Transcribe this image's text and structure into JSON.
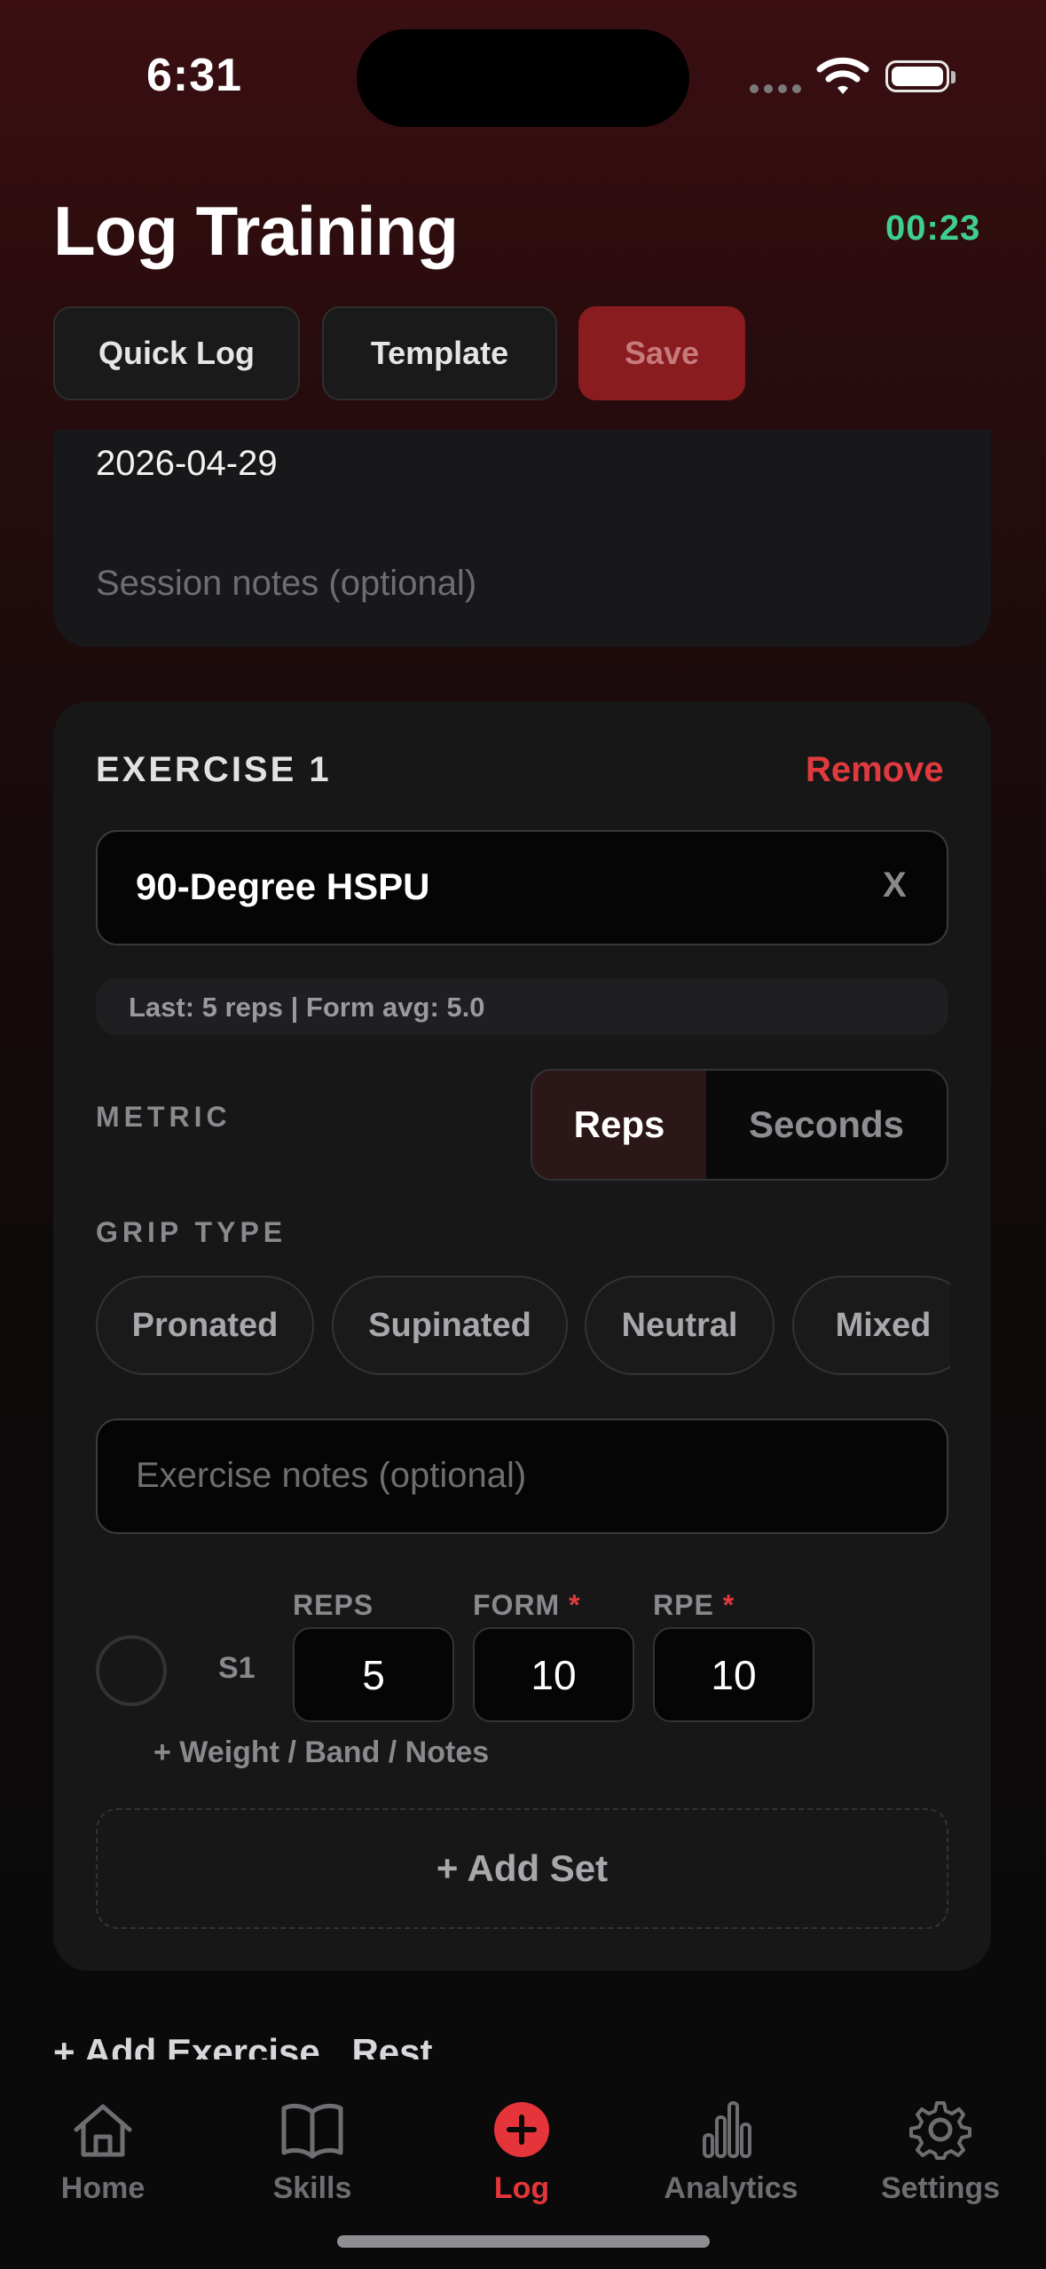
{
  "status_bar": {
    "time": "6:31"
  },
  "header": {
    "title": "Log Training",
    "timer": "00:23"
  },
  "actions": {
    "quick_log": "Quick Log",
    "template": "Template",
    "save": "Save"
  },
  "session": {
    "date": "2026-04-29",
    "notes_placeholder": "Session notes (optional)"
  },
  "exercise": {
    "label": "EXERCISE 1",
    "remove": "Remove",
    "name": "90-Degree HSPU",
    "clear": "X",
    "last": "Last: 5 reps | Form avg: 5.0",
    "metric_label": "METRIC",
    "metric_options": [
      "Reps",
      "Seconds"
    ],
    "metric_selected": "Reps",
    "grip_label": "GRIP TYPE",
    "grip_options": [
      "Pronated",
      "Supinated",
      "Neutral",
      "Mixed"
    ],
    "notes_placeholder": "Exercise notes (optional)",
    "set_headers": {
      "reps": "REPS",
      "form": "FORM",
      "rpe": "RPE",
      "required": "*"
    },
    "sets": [
      {
        "label": "S1",
        "reps": "5",
        "form": "10",
        "rpe": "10"
      }
    ],
    "extras": "+ Weight / Band / Notes",
    "add_set": "+ Add Set"
  },
  "footer_links": {
    "add_exercise": "+ Add Exercise",
    "rest": "Rest"
  },
  "tabbar": {
    "items": [
      {
        "label": "Home",
        "icon": "home-icon"
      },
      {
        "label": "Skills",
        "icon": "book-icon"
      },
      {
        "label": "Log",
        "icon": "plus-circle-icon"
      },
      {
        "label": "Analytics",
        "icon": "bar-chart-icon"
      },
      {
        "label": "Settings",
        "icon": "gear-icon"
      }
    ],
    "active": "Log"
  },
  "colors": {
    "accent": "#e5343a",
    "timer": "#3ecf8e",
    "save_bg": "#8a1c1f"
  }
}
